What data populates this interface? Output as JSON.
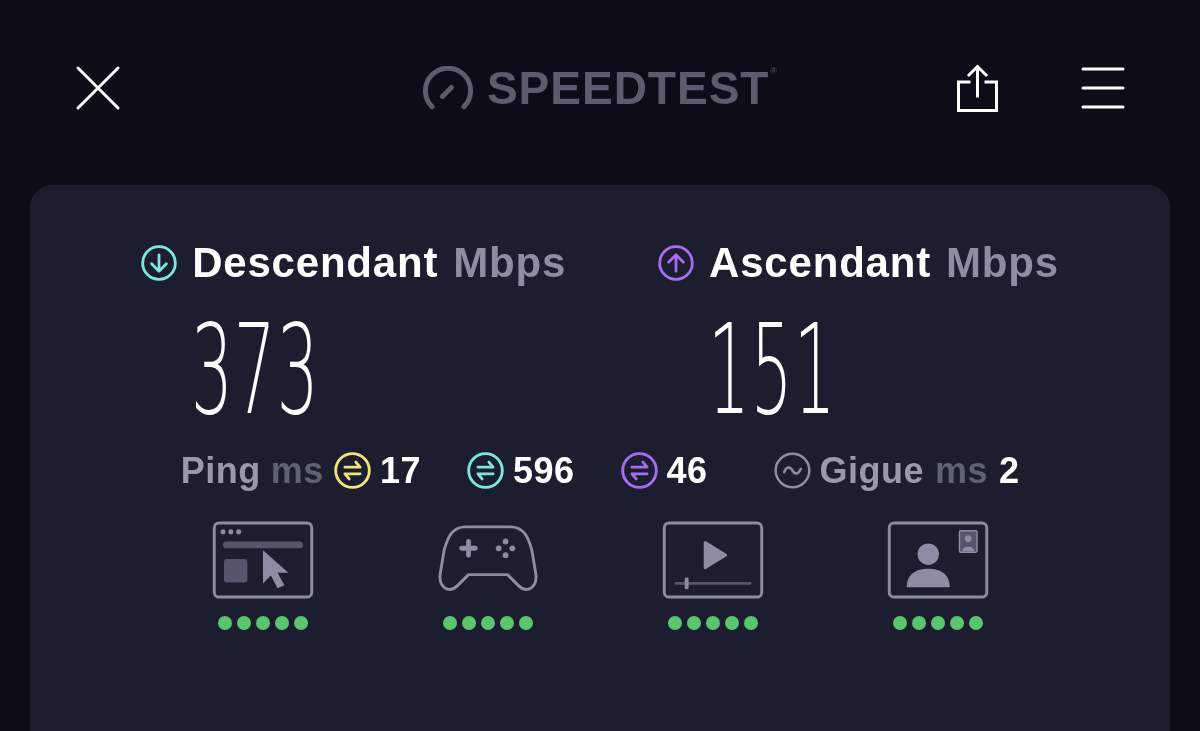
{
  "header": {
    "logo": {
      "text": "SPEEDTEST",
      "mark": "®"
    }
  },
  "speeds": [
    {
      "kind": "download",
      "label": "Descendant",
      "unit": "Mbps",
      "value": "373",
      "color": "#7be8df"
    },
    {
      "kind": "upload",
      "label": "Ascendant",
      "unit": "Mbps",
      "value": "151",
      "color": "#a56ef2"
    }
  ],
  "ping": {
    "label": "Ping",
    "unit": "ms",
    "values": [
      {
        "value": "17",
        "color": "#f2e37a"
      },
      {
        "value": "596",
        "color": "#7be8df"
      },
      {
        "value": "46",
        "color": "#a56ef2"
      }
    ]
  },
  "jitter": {
    "label": "Gigue",
    "unit": "ms",
    "value": "2"
  },
  "use_cases": [
    {
      "kind": "browsing",
      "stars": 5
    },
    {
      "kind": "gaming",
      "stars": 5
    },
    {
      "kind": "video",
      "stars": 5
    },
    {
      "kind": "video_call",
      "stars": 5
    }
  ]
}
